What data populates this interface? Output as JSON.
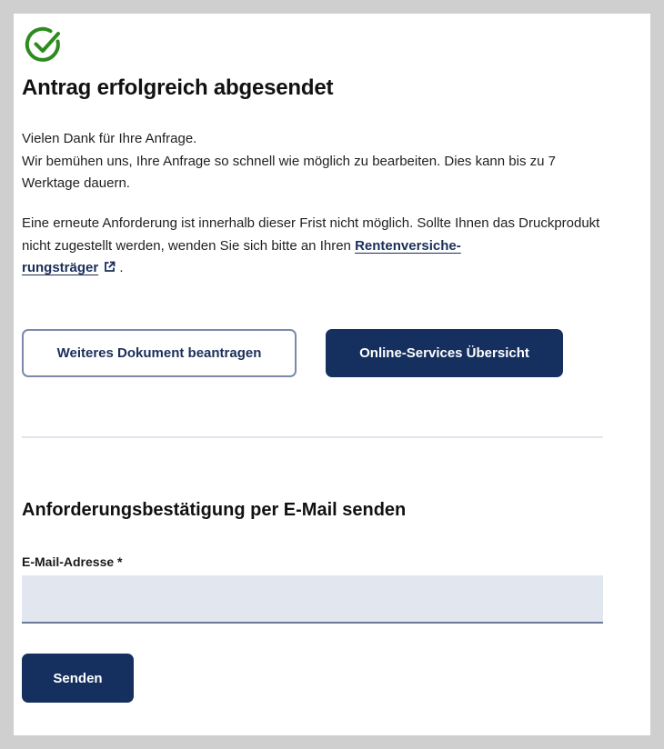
{
  "success": {
    "icon": "check-circle-icon",
    "title": "Antrag erfolgreich abgesendet"
  },
  "message": {
    "line1": "Vielen Dank für Ihre Anfrage.",
    "line2": "Wir bemühen uns, Ihre Anfrage so schnell wie möglich zu bearbeiten. Dies kann bis zu 7 Werktage dauern.",
    "p2_text": "Eine erneute Anforderung ist innerhalb dieser Frist nicht möglich. Sollte Ihnen das Druckprodukt nicht zugestellt werden, wenden Sie sich bitte an Ihren ",
    "link_part1": "Rentenversiche-",
    "link_part2": "rungsträger",
    "p2_end": "."
  },
  "actions": {
    "secondary_label": "Weiteres Dokument beantragen",
    "primary_label": "Online-Services Übersicht"
  },
  "email_section": {
    "title": "Anforderungsbestätigung per E-Mail senden",
    "field_label": "E-Mail-Adresse *",
    "field_value": "",
    "send_label": "Senden"
  },
  "colors": {
    "success_green": "#2e8b1e",
    "primary_navy": "#15305f",
    "outline_border": "#7a8aa8",
    "input_bg": "#e2e6ef"
  }
}
